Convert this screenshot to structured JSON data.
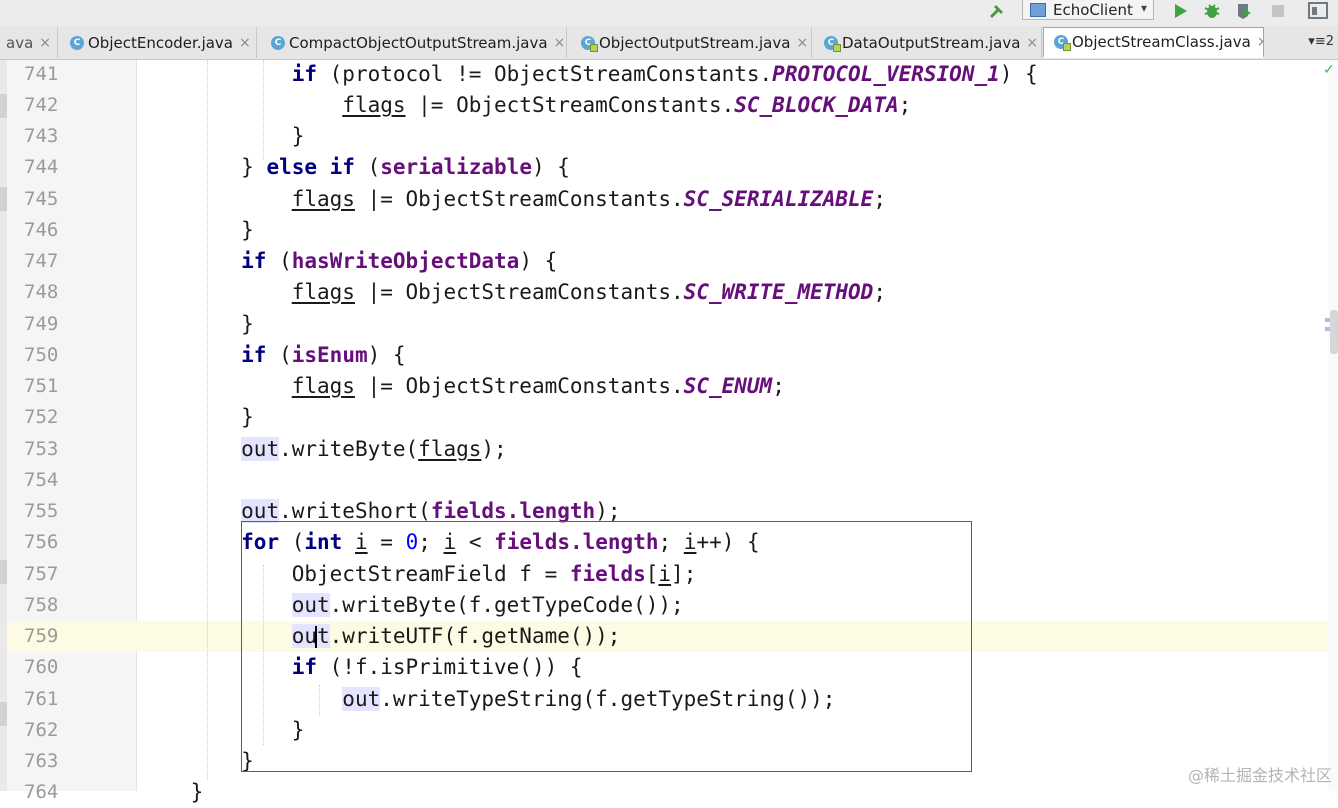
{
  "toolbar": {
    "run_config": "EchoClient",
    "icons": [
      "build-hammer-icon",
      "run-icon",
      "debug-icon",
      "coverage-icon",
      "stop-icon",
      "project-structure-icon"
    ]
  },
  "tabs": [
    {
      "label": "ava",
      "close": "×",
      "icon": ""
    },
    {
      "label": "ObjectEncoder.java",
      "close": "×",
      "icon": "C"
    },
    {
      "label": "CompactObjectOutputStream.java",
      "close": "×",
      "icon": "C"
    },
    {
      "label": "ObjectOutputStream.java",
      "close": "×",
      "icon": "C"
    },
    {
      "label": "DataOutputStream.java",
      "close": "×",
      "icon": "C"
    },
    {
      "label": "ObjectStreamClass.java",
      "close": "×",
      "icon": "C"
    }
  ],
  "tab_overflow": "▾≡2",
  "editor": {
    "line_numbers": [
      "741",
      "742",
      "743",
      "744",
      "745",
      "746",
      "747",
      "748",
      "749",
      "750",
      "751",
      "752",
      "753",
      "754",
      "755",
      "756",
      "757",
      "758",
      "759",
      "760",
      "761",
      "762",
      "763",
      "764"
    ],
    "current_line": "759"
  },
  "watermark": "@稀土掘金技术社区",
  "colors": {
    "keyword": "#000080",
    "constant": "#660e7a",
    "number": "#0000ff",
    "current_line_bg": "#fdfbe3",
    "selection_border": "#e0262a"
  }
}
